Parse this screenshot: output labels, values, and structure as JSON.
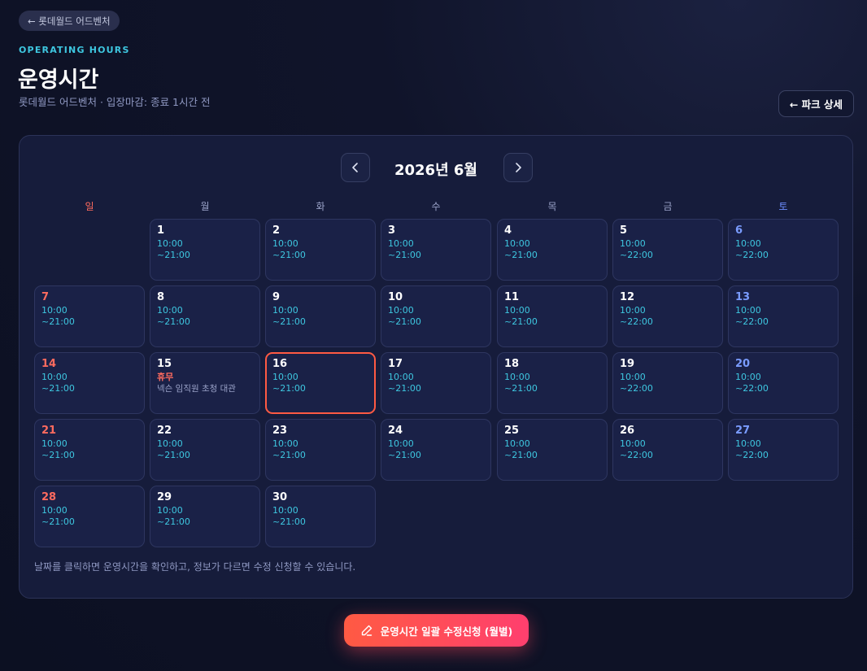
{
  "header": {
    "back_label": "← 롯데월드 어드벤처",
    "eyebrow": "OPERATING HOURS",
    "title": "운영시간",
    "subtitle": "롯데월드 어드벤처 · 입장마감: 종료 1시간 전",
    "park_button_label": "← 파크 상세"
  },
  "calendar": {
    "month_title": "2026년 6월",
    "weekdays": [
      "일",
      "월",
      "화",
      "수",
      "목",
      "금",
      "토"
    ],
    "days": [
      {
        "day": "1",
        "weekday": 1,
        "open": "10:00",
        "close": "~21:00"
      },
      {
        "day": "2",
        "weekday": 2,
        "open": "10:00",
        "close": "~21:00"
      },
      {
        "day": "3",
        "weekday": 3,
        "open": "10:00",
        "close": "~21:00"
      },
      {
        "day": "4",
        "weekday": 4,
        "open": "10:00",
        "close": "~21:00"
      },
      {
        "day": "5",
        "weekday": 5,
        "open": "10:00",
        "close": "~22:00"
      },
      {
        "day": "6",
        "weekday": 6,
        "open": "10:00",
        "close": "~22:00"
      },
      {
        "day": "7",
        "weekday": 0,
        "open": "10:00",
        "close": "~21:00"
      },
      {
        "day": "8",
        "weekday": 1,
        "open": "10:00",
        "close": "~21:00"
      },
      {
        "day": "9",
        "weekday": 2,
        "open": "10:00",
        "close": "~21:00"
      },
      {
        "day": "10",
        "weekday": 3,
        "open": "10:00",
        "close": "~21:00"
      },
      {
        "day": "11",
        "weekday": 4,
        "open": "10:00",
        "close": "~21:00"
      },
      {
        "day": "12",
        "weekday": 5,
        "open": "10:00",
        "close": "~22:00"
      },
      {
        "day": "13",
        "weekday": 6,
        "open": "10:00",
        "close": "~22:00"
      },
      {
        "day": "14",
        "weekday": 0,
        "open": "10:00",
        "close": "~21:00"
      },
      {
        "day": "15",
        "weekday": 1,
        "closed_label": "휴무",
        "note": "넥슨 임직원 초청 대관"
      },
      {
        "day": "16",
        "weekday": 2,
        "open": "10:00",
        "close": "~21:00",
        "today": true
      },
      {
        "day": "17",
        "weekday": 3,
        "open": "10:00",
        "close": "~21:00"
      },
      {
        "day": "18",
        "weekday": 4,
        "open": "10:00",
        "close": "~21:00"
      },
      {
        "day": "19",
        "weekday": 5,
        "open": "10:00",
        "close": "~22:00"
      },
      {
        "day": "20",
        "weekday": 6,
        "open": "10:00",
        "close": "~22:00"
      },
      {
        "day": "21",
        "weekday": 0,
        "open": "10:00",
        "close": "~21:00"
      },
      {
        "day": "22",
        "weekday": 1,
        "open": "10:00",
        "close": "~21:00"
      },
      {
        "day": "23",
        "weekday": 2,
        "open": "10:00",
        "close": "~21:00"
      },
      {
        "day": "24",
        "weekday": 3,
        "open": "10:00",
        "close": "~21:00"
      },
      {
        "day": "25",
        "weekday": 4,
        "open": "10:00",
        "close": "~21:00"
      },
      {
        "day": "26",
        "weekday": 5,
        "open": "10:00",
        "close": "~22:00"
      },
      {
        "day": "27",
        "weekday": 6,
        "open": "10:00",
        "close": "~22:00"
      },
      {
        "day": "28",
        "weekday": 0,
        "open": "10:00",
        "close": "~21:00"
      },
      {
        "day": "29",
        "weekday": 1,
        "open": "10:00",
        "close": "~21:00"
      },
      {
        "day": "30",
        "weekday": 2,
        "open": "10:00",
        "close": "~21:00"
      }
    ],
    "hint": "날짜를 클릭하면 운영시간을 확인하고, 정보가 다르면 수정 신청할 수 있습니다."
  },
  "cta": {
    "label": "운영시간 일괄 수정신청 (월별)",
    "icon": "pencil-icon"
  },
  "colors": {
    "accent_cyan": "#3ec7e0",
    "sunday_red": "#ff6b5f",
    "saturday_blue": "#7a9cff",
    "cta_gradient_start": "#ff5a43",
    "cta_gradient_end": "#ff3f6e"
  }
}
